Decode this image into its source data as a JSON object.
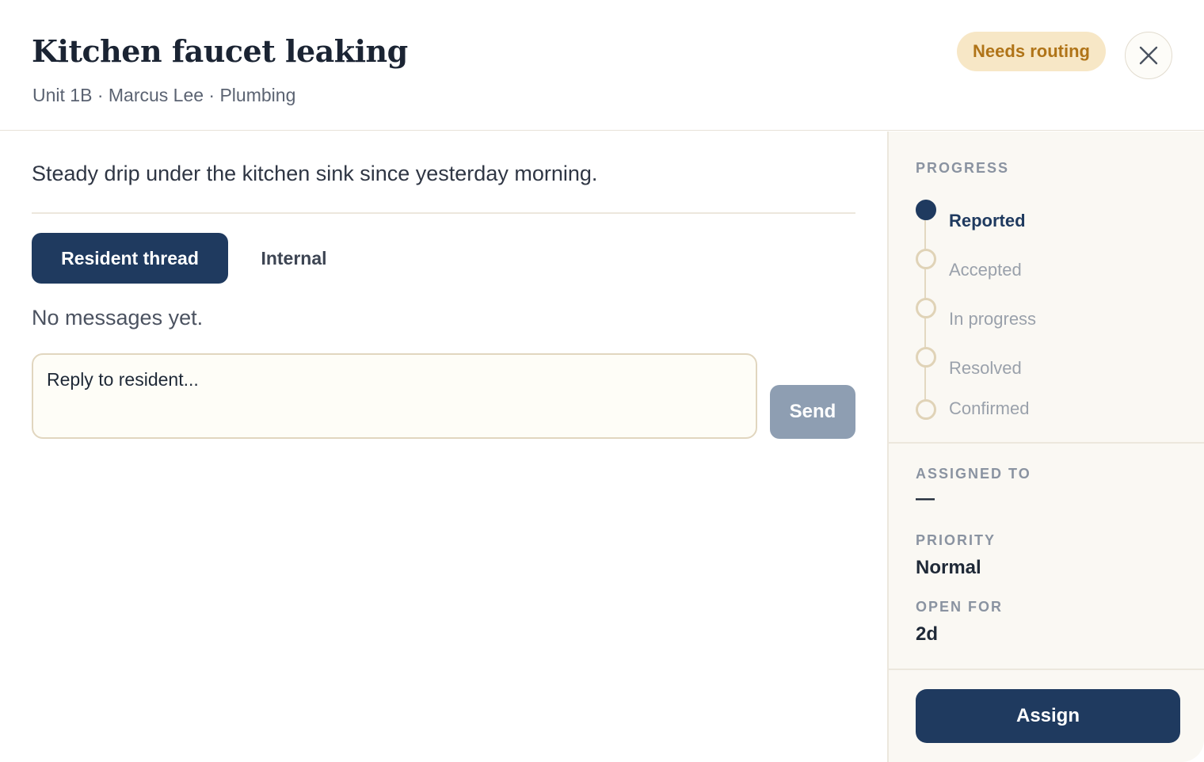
{
  "header": {
    "title": "Kitchen faucet leaking",
    "subtitle": "Unit 1B · Marcus Lee · Plumbing",
    "status_badge": "Needs routing",
    "close_icon": "close-icon"
  },
  "main": {
    "description": "Steady drip under the kitchen sink since yesterday morning.",
    "tabs": [
      {
        "label": "Resident thread",
        "active": true
      },
      {
        "label": "Internal",
        "active": false
      }
    ],
    "empty_message": "No messages yet.",
    "reply_placeholder": "Reply to resident...",
    "send_label": "Send"
  },
  "sidebar": {
    "progress_label": "PROGRESS",
    "steps": [
      {
        "label": "Reported",
        "done": true
      },
      {
        "label": "Accepted",
        "done": false
      },
      {
        "label": "In progress",
        "done": false
      },
      {
        "label": "Resolved",
        "done": false
      },
      {
        "label": "Confirmed",
        "done": false
      }
    ],
    "assigned_label": "ASSIGNED TO",
    "assigned_value": "—",
    "priority_label": "PRIORITY",
    "priority_value": "Normal",
    "open_for_label": "OPEN FOR",
    "open_for_value": "2d",
    "assign_label": "Assign"
  },
  "colors": {
    "primary": "#1f3a5f",
    "badge_bg": "#f7e7c6",
    "badge_text": "#b07418",
    "send_disabled": "#8e9eb2",
    "sidebar_bg": "#faf8f3"
  }
}
